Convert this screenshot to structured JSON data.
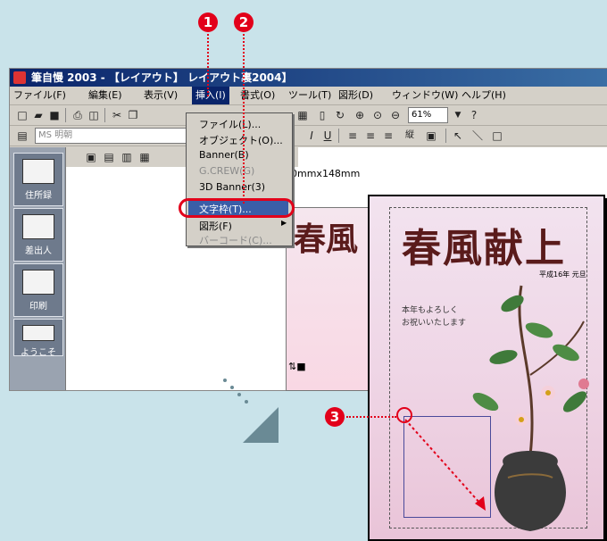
{
  "window": {
    "title": "筆自慢 2003 - 【レイアウト】 レイアウト裏2004】"
  },
  "menubar": {
    "items": [
      "ファイル(F)",
      "編集(E)",
      "表示(V)",
      "挿入(I)",
      "書式(O)",
      "ツール(T)",
      "図形(D)",
      "ウィンドウ(W)",
      "ヘルプ(H)"
    ],
    "active": "挿入(I)"
  },
  "toolbar": {
    "font_name": "MS 明朝",
    "zoom": "61%"
  },
  "insert_menu": {
    "items": [
      {
        "label": "ファイル(L)...",
        "enabled": true
      },
      {
        "label": "オブジェクト(O)...",
        "enabled": true
      },
      {
        "label": "Banner(B)",
        "enabled": true
      },
      {
        "label": "G.CREW(G)",
        "enabled": false
      },
      {
        "label": "3D Banner(3)",
        "enabled": true
      },
      {
        "label": "文字枠(T)...",
        "enabled": true,
        "highlighted": true
      },
      {
        "label": "図形(F)",
        "enabled": true,
        "submenu": true
      },
      {
        "label": "バーコード(C)...",
        "enabled": false
      }
    ]
  },
  "paper_size": "0mmx148mm",
  "sidebar": {
    "items": [
      {
        "label": "住所録",
        "icon": "address-book-icon"
      },
      {
        "label": "差出人",
        "icon": "sender-icon"
      },
      {
        "label": "印刷",
        "icon": "printer-icon"
      },
      {
        "label": "ようこそ",
        "icon": "welcome-icon"
      }
    ]
  },
  "card": {
    "title": "春風献上",
    "date": "平成16年 元旦",
    "greeting_line1": "本年もよろしく",
    "greeting_line2": "お祝いいたします"
  },
  "card_back": {
    "title": "春風"
  },
  "steps": [
    "1",
    "2",
    "3"
  ],
  "colors": {
    "accent": "#e2001a",
    "highlight": "#3a5ea8",
    "titlebar": "#0a246a"
  }
}
